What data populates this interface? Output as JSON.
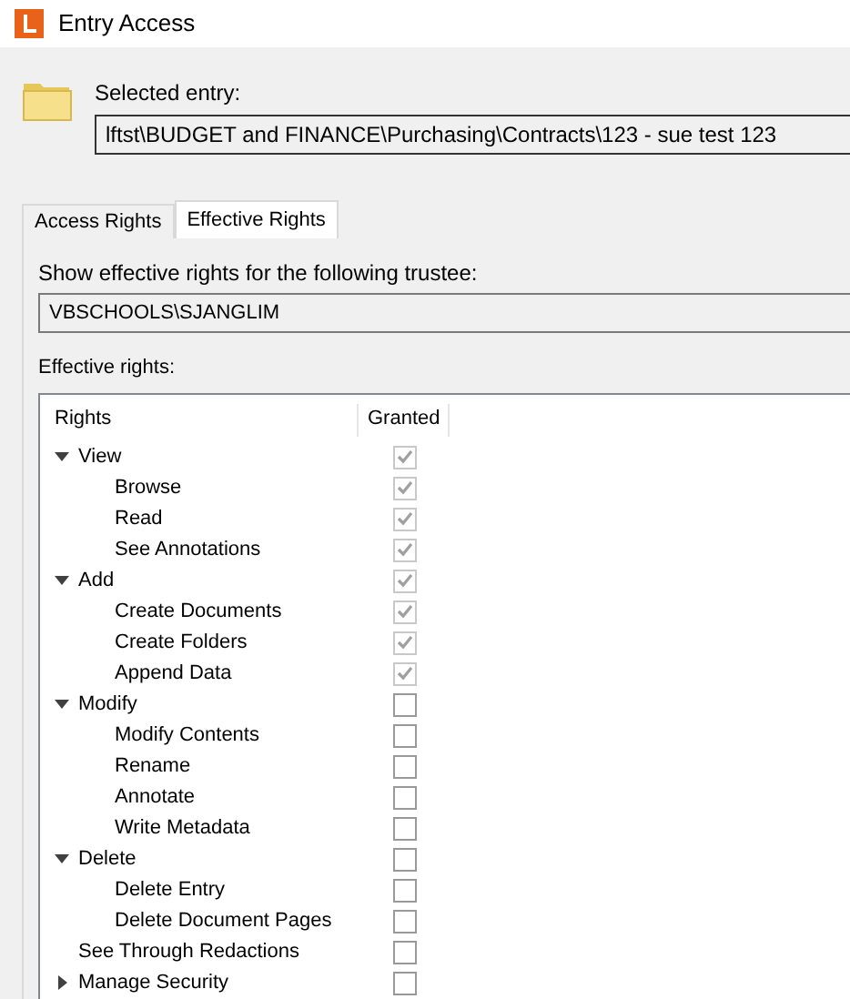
{
  "window": {
    "title": "Entry Access"
  },
  "selected_entry": {
    "label": "Selected entry:",
    "value": "lftst\\BUDGET and FINANCE\\Purchasing\\Contracts\\123 - sue test 123"
  },
  "tabs": [
    {
      "label": "Access Rights",
      "selected": false
    },
    {
      "label": "Effective Rights",
      "selected": true
    }
  ],
  "trustee": {
    "label": "Show effective rights for the following trustee:",
    "value": "VBSCHOOLS\\SJANGLIM"
  },
  "effective_rights": {
    "label": "Effective rights:",
    "columns": [
      "Rights",
      "Granted"
    ],
    "rows": [
      {
        "label": "View",
        "granted": true,
        "expanded": true,
        "children": [
          {
            "label": "Browse",
            "granted": true
          },
          {
            "label": "Read",
            "granted": true
          },
          {
            "label": "See Annotations",
            "granted": true
          }
        ]
      },
      {
        "label": "Add",
        "granted": true,
        "expanded": true,
        "children": [
          {
            "label": "Create Documents",
            "granted": true
          },
          {
            "label": "Create Folders",
            "granted": true
          },
          {
            "label": "Append Data",
            "granted": true
          }
        ]
      },
      {
        "label": "Modify",
        "granted": false,
        "expanded": true,
        "children": [
          {
            "label": "Modify Contents",
            "granted": false
          },
          {
            "label": "Rename",
            "granted": false
          },
          {
            "label": "Annotate",
            "granted": false
          },
          {
            "label": "Write Metadata",
            "granted": false
          }
        ]
      },
      {
        "label": "Delete",
        "granted": false,
        "expanded": true,
        "children": [
          {
            "label": "Delete Entry",
            "granted": false
          },
          {
            "label": "Delete Document Pages",
            "granted": false
          }
        ]
      },
      {
        "label": "See Through Redactions",
        "granted": false
      },
      {
        "label": "Manage Security",
        "granted": false,
        "expanded": false
      }
    ]
  }
}
